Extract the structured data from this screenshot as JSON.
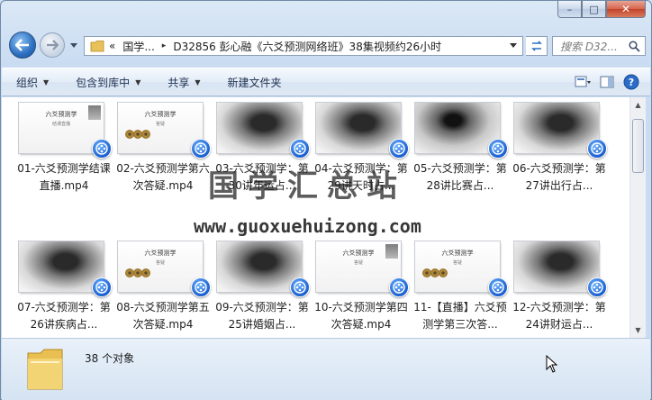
{
  "window": {
    "caption": {
      "minimize": "–",
      "maximize": "□",
      "close": "✕"
    }
  },
  "address": {
    "chevrons": "«",
    "segments": [
      "国学...",
      "D32856 彭心融《六爻预测网络班》38集视频约26小时"
    ],
    "separator": "▸",
    "search_placeholder": "搜索 D32..."
  },
  "toolbar": {
    "items": [
      {
        "label": "组织",
        "dropdown": true
      },
      {
        "label": "包含到库中",
        "dropdown": true
      },
      {
        "label": "共享",
        "dropdown": true
      },
      {
        "label": "新建文件夹",
        "dropdown": false
      }
    ]
  },
  "files": [
    {
      "name": "01-六爻预测学结课直播.mp4",
      "thumb": "white-title",
      "thumb_title": "六爻预测学",
      "thumb_sub": "结课直播"
    },
    {
      "name": "02-六爻预测学第六次答疑.mp4",
      "thumb": "white-coins",
      "thumb_title": "六爻预测学",
      "thumb_sub": "答疑"
    },
    {
      "name": "03-六爻预测学：第30讲年运占...",
      "thumb": "dark"
    },
    {
      "name": "04-六爻预测学：第29讲天时占...",
      "thumb": "dark"
    },
    {
      "name": "05-六爻预测学：第28讲比赛占...",
      "thumb": "ink"
    },
    {
      "name": "06-六爻预测学：第27讲出行占...",
      "thumb": "dark"
    },
    {
      "name": "07-六爻预测学：第26讲疾病占...",
      "thumb": "dark"
    },
    {
      "name": "08-六爻预测学第五次答疑.mp4",
      "thumb": "white-coins",
      "thumb_title": "六爻预测学",
      "thumb_sub": "答疑"
    },
    {
      "name": "09-六爻预测学：第25讲婚姻占...",
      "thumb": "dark"
    },
    {
      "name": "10-六爻预测学第四次答疑.mp4",
      "thumb": "white-title",
      "thumb_title": "六爻预测学",
      "thumb_sub": "答疑"
    },
    {
      "name": "11-【直播】六爻预测学第三次答...",
      "thumb": "white-coins",
      "thumb_title": "六爻预测学",
      "thumb_sub": "答疑"
    },
    {
      "name": "12-六爻预测学：第24讲财运占...",
      "thumb": "dark"
    }
  ],
  "watermark": {
    "title": "国学汇总站",
    "url": "www.guoxuehuizong.com"
  },
  "status": {
    "count": "38 个对象"
  },
  "colors": {
    "badge": "#1a5fd0",
    "toolbar_text": "#1e3050",
    "close": "#c3432a"
  }
}
